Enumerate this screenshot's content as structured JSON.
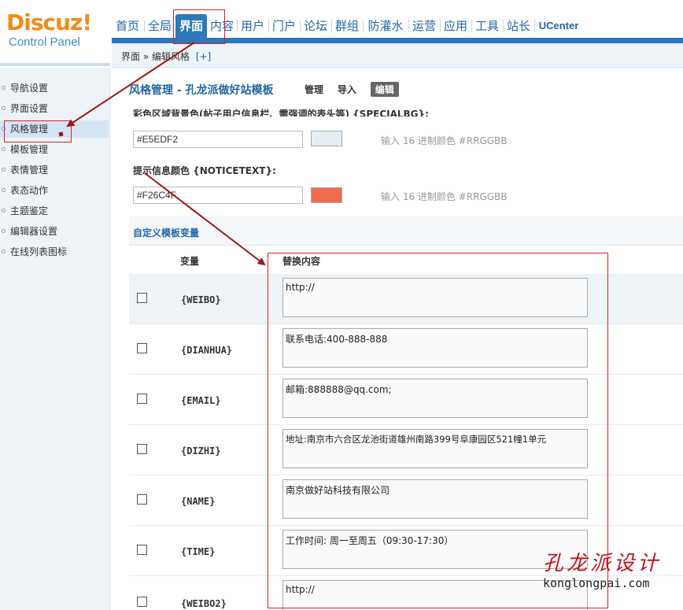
{
  "logo": {
    "brand": "Discuz",
    "bang": "!",
    "subtitle": "Control Panel"
  },
  "topnav": [
    {
      "label": "首页"
    },
    {
      "label": "全局"
    },
    {
      "label": "界面",
      "active": true
    },
    {
      "label": "内容"
    },
    {
      "label": "用户"
    },
    {
      "label": "门户"
    },
    {
      "label": "论坛"
    },
    {
      "label": "群组"
    },
    {
      "label": "防灌水"
    },
    {
      "label": "运营"
    },
    {
      "label": "应用"
    },
    {
      "label": "工具"
    },
    {
      "label": "站长"
    },
    {
      "label": "UCenter"
    }
  ],
  "breadcrumb": {
    "text": "界面 » 编辑风格",
    "plus": "[+]"
  },
  "sidebar": {
    "items": [
      {
        "label": "导航设置"
      },
      {
        "label": "界面设置"
      },
      {
        "label": "风格管理",
        "active": true
      },
      {
        "label": "模板管理"
      },
      {
        "label": "表情管理"
      },
      {
        "label": "表态动作"
      },
      {
        "label": "主题鉴定"
      },
      {
        "label": "编辑器设置"
      },
      {
        "label": "在线列表图标"
      }
    ]
  },
  "main": {
    "title": "风格管理 - 孔龙派做好站模板",
    "tabs": {
      "manage": "管理",
      "import": "导入",
      "edit": "编辑"
    },
    "cut_label": "彩色区域背景色(帖子用户信息栏、需强调的表头等) {SPECIALBG}:",
    "specialbg": {
      "value": "#E5EDF2",
      "color": "#E5EDF2",
      "hint": "输入 16 进制颜色 #RRGGBB"
    },
    "notice": {
      "label": "提示信息颜色 {NOTICETEXT}:",
      "value": "#F26C4F",
      "color": "#F26C4F",
      "hint": "输入 16 进制颜色 #RRGGBB"
    },
    "custom_vars": {
      "title": "自定义模板变量",
      "col_var": "变量",
      "col_content": "替换内容",
      "rows": [
        {
          "name": "{WEIBO}",
          "value": "http://"
        },
        {
          "name": "{DIANHUA}",
          "value": "联系电话:400-888-888"
        },
        {
          "name": "{EMAIL}",
          "value": "邮箱:888888@qq.com;"
        },
        {
          "name": "{DIZHI}",
          "value": "地址:南京市六合区龙池街道雄州南路399号阜康园区521幢1单元"
        },
        {
          "name": "{NAME}",
          "value": "南京做好站科技有限公司"
        },
        {
          "name": "{TIME}",
          "value": "工作时间: 周一至周五（09:30-17:30）"
        },
        {
          "name": "{WEIBO2}",
          "value": "http://"
        }
      ]
    }
  },
  "watermark": {
    "cn": "孔龙派设计",
    "en": "konglongpai.com"
  },
  "colors": {
    "accent": "#2d78b8",
    "annotation": "#e02020"
  }
}
